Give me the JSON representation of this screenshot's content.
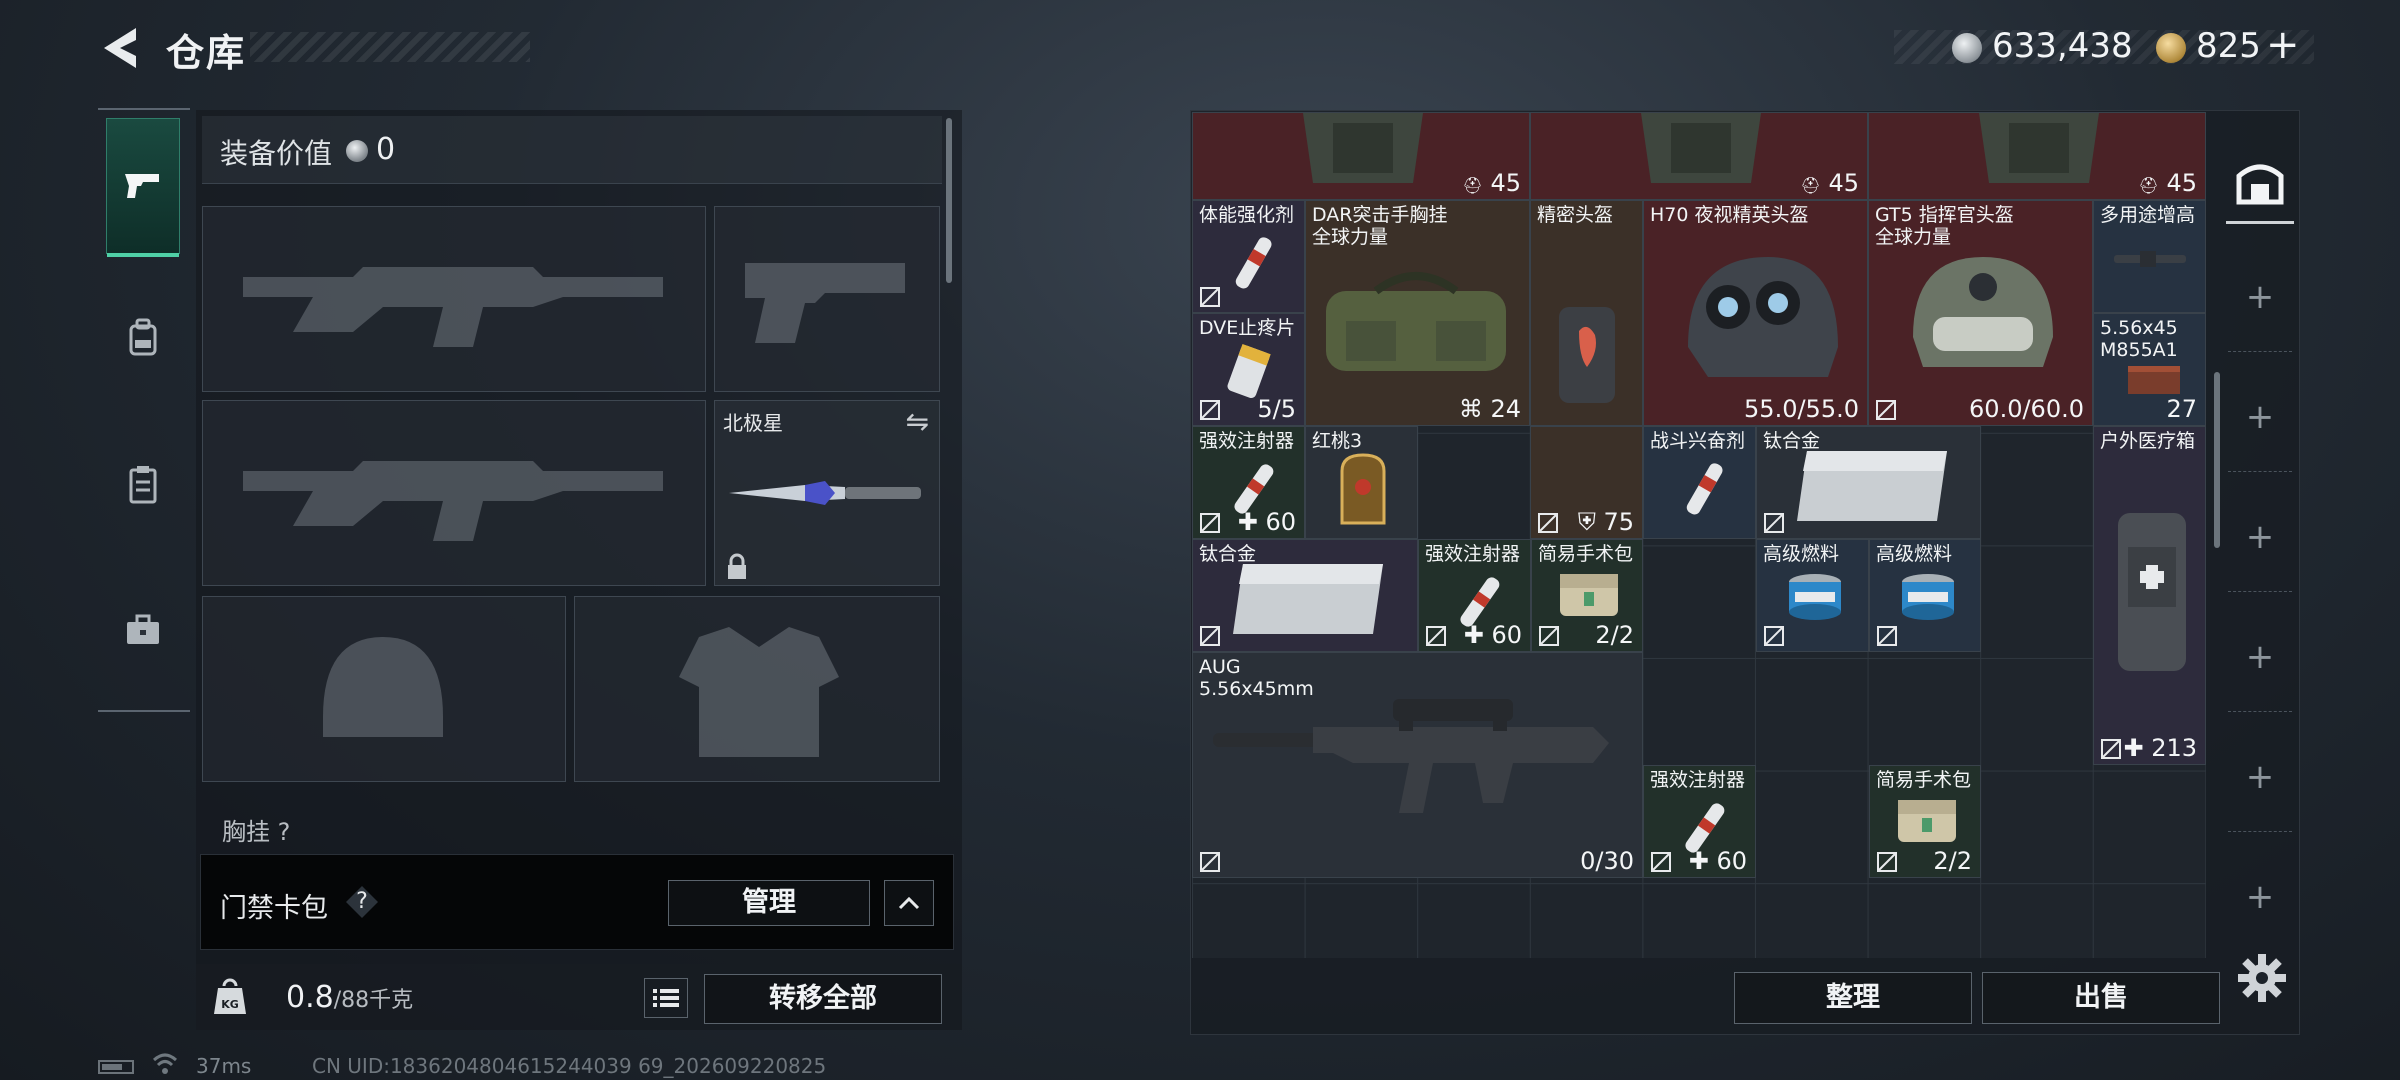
{
  "header": {
    "title": "仓库",
    "silver_amount": "633,438",
    "gold_amount": "825",
    "gold_plus": "+"
  },
  "nav_tabs": [
    {
      "id": "weapons",
      "icon": "pistol-icon",
      "active": true
    },
    {
      "id": "backpack",
      "icon": "backpack-icon",
      "active": false
    },
    {
      "id": "clipboard",
      "icon": "clipboard-icon",
      "active": false
    },
    {
      "id": "toolbox",
      "icon": "toolbox-icon",
      "active": false
    }
  ],
  "equipment": {
    "value_label": "装备价值",
    "value": "0",
    "melee_label": "北极星",
    "chest_label": "胸挂",
    "chest_count": "?"
  },
  "access_card": {
    "label": "门禁卡包",
    "help": "?",
    "manage": "管理"
  },
  "weight": {
    "current": "0.8",
    "max": "/88千克",
    "transfer_all": "转移全部"
  },
  "status": {
    "ping": "37ms",
    "uid": "CN UID:1836204804615244039 69_202609220825"
  },
  "stash": {
    "items": [
      {
        "id": "vest-a",
        "name": "",
        "count": "45",
        "bg": "bg-red"
      },
      {
        "id": "vest-b",
        "name": "",
        "count": "45",
        "bg": "bg-red"
      },
      {
        "id": "vest-c",
        "name": "",
        "count": "45",
        "bg": "bg-red"
      },
      {
        "id": "stamina",
        "name": "体能强化剂",
        "count": "",
        "bg": "bg-purple"
      },
      {
        "id": "dar-rig",
        "name": "DAR突击手胸挂",
        "name2": "全球力量",
        "count": "24",
        "bg": "bg-brown"
      },
      {
        "id": "precision-helmet",
        "name": "精密头盔",
        "count": "",
        "bg": "bg-brown"
      },
      {
        "id": "h70-helmet",
        "name": "H70 夜视精英头盔",
        "count": "55.0/55.0",
        "bg": "bg-red"
      },
      {
        "id": "gt5-helmet",
        "name": "GT5 指挥官头盔",
        "name2": "全球力量",
        "count": "60.0/60.0",
        "bg": "bg-red"
      },
      {
        "id": "multi-tool",
        "name": "多用途增高",
        "count": "",
        "bg": "bg-blue"
      },
      {
        "id": "dve-painkiller",
        "name": "DVE止疼片",
        "count": "5/5",
        "bg": "bg-purple"
      },
      {
        "id": "ammo-556",
        "name": "5.56x45",
        "name2": "M855A1",
        "count": "27",
        "bg": "bg-blue"
      },
      {
        "id": "injector-1",
        "name": "强效注射器",
        "count": "60",
        "bg": "bg-green"
      },
      {
        "id": "red-peach",
        "name": "红桃3",
        "count": "",
        "bg": "bg-gray"
      },
      {
        "id": "helmet-armor",
        "name": "",
        "count": "75",
        "bg": "bg-brown"
      },
      {
        "id": "combat-stim",
        "name": "战斗兴奋剂",
        "count": "",
        "bg": "bg-blue"
      },
      {
        "id": "titanium-1",
        "name": "钛合金",
        "count": "",
        "bg": "bg-gray"
      },
      {
        "id": "outdoor-med",
        "name": "户外医疗箱",
        "count": "213",
        "bg": "bg-purple"
      },
      {
        "id": "titanium-2",
        "name": "钛合金",
        "count": "",
        "bg": "bg-purple"
      },
      {
        "id": "injector-2",
        "name": "强效注射器",
        "count": "60",
        "bg": "bg-green"
      },
      {
        "id": "surgery-kit-1",
        "name": "简易手术包",
        "count": "2/2",
        "bg": "bg-green"
      },
      {
        "id": "fuel-1",
        "name": "高级燃料",
        "count": "",
        "bg": "bg-blue"
      },
      {
        "id": "fuel-2",
        "name": "高级燃料",
        "count": "",
        "bg": "bg-blue"
      },
      {
        "id": "aug",
        "name": "AUG",
        "name2": "5.56x45mm",
        "count": "0/30",
        "bg": "bg-gray"
      },
      {
        "id": "injector-3",
        "name": "强效注射器",
        "count": "60",
        "bg": "bg-green"
      },
      {
        "id": "surgery-kit-2",
        "name": "简易手术包",
        "count": "2/2",
        "bg": "bg-green"
      }
    ],
    "sort": "整理",
    "sell": "出售"
  },
  "colors": {
    "accent_green": "#4fd0a6",
    "rare_red": "#4a2226",
    "epic_purple": "#2d2b3c"
  }
}
